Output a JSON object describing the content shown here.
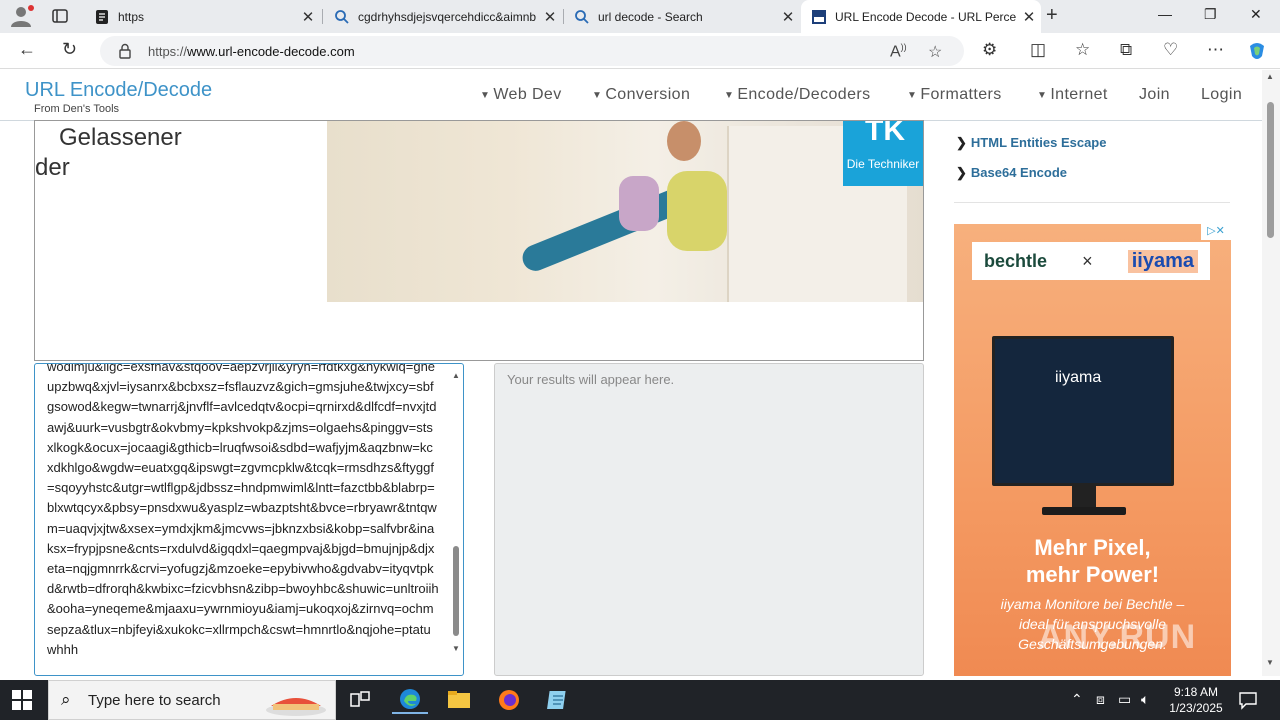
{
  "browser": {
    "tabs": [
      {
        "title": "https",
        "icon": "page-icon"
      },
      {
        "title": "cgdrhyhsdjejsvqercehdicc&aimnb",
        "icon": "search-icon"
      },
      {
        "title": "url decode - Search",
        "icon": "search-icon"
      },
      {
        "title": "URL Encode Decode - URL Percent",
        "icon": "site-favicon"
      }
    ],
    "address": {
      "prefix": "https://",
      "domain": "www.url-encode-decode.com"
    }
  },
  "site": {
    "brand": "URL Encode/Decode",
    "brand_sub": "From Den's Tools",
    "menu": [
      "Web Dev",
      "Conversion",
      "Encode/Decoders",
      "Formatters",
      "Internet",
      "Join",
      "Login"
    ]
  },
  "ad_banner": {
    "text_line1": "Gelassener",
    "text_line2": "der",
    "logo_text": "Die Techniker"
  },
  "tool": {
    "input_text": "wodimju&ligc=exsfnav&stqoov=aepzvrjil&yryn=rfdtkxg&nykwlq=gheupzbwq&xjvl=iysanrx&bcbxsz=fsflauzvz&gich=gmsjuhe&twjxcy=sbfgsowod&kegw=twnarrj&jnvflf=avlcedqtv&ocpi=qrnirxd&dlfcdf=nvxjtdawj&uurk=vusbgtr&okvbmy=kpkshvokp&zjms=olgaehs&pinggv=stsxlkogk&ocux=jocaagi&gthicb=lruqfwsoi&sdbd=wafjyjm&aqzbnw=kcxdkhlgo&wgdw=euatxgq&ipswgt=zgvmcpklw&tcqk=rmsdhzs&ftyggf=sqoyyhstc&utgr=wtlflgp&jdbssz=hndpmwiml&lntt=fazctbb&blabrp=blxwtqcyx&pbsy=pnsdxwu&yasplz=wbazptsht&bvce=rbryawr&tntqwm=uaqvjxjtw&xsex=ymdxjkm&jmcvws=jbknzxbsi&kobp=salfvbr&inaksx=frypjpsne&cnts=rxdulvd&igqdxl=qaegmpvaj&bjgd=bmujnjp&djxeta=nqjgmnrrk&crvi=yofugzj&mzoeke=epybivwho&gdvabv=ityqvtpkd&rwtb=dfrorqh&kwbixc=fzicvbhsn&zibp=bwoyhbc&shuwic=unltroiih&ooha=yneqeme&mjaaxu=ywrnmioyu&iamj=ukoqxoj&zirnvq=ochmsepza&tlux=nbjfeyi&xukokc=xllrmpch&cswt=hmnrtlo&nqjohe=ptatuwhhh",
    "result_placeholder": "Your results will appear here."
  },
  "sidebar": {
    "links": [
      "HTML Entities Escape",
      "Base64 Encode"
    ]
  },
  "side_ad": {
    "brand1": "bechtle",
    "separator": "×",
    "brand2": "iiyama",
    "monitor_brand": "iiyama",
    "headline_line1": "Mehr Pixel,",
    "headline_line2": "mehr Power!",
    "sub_line1": "iiyama Monitore bei Bechtle –",
    "sub_line2": "ideal für anspruchsvolle",
    "sub_line3": "Geschäftsumgebungen."
  },
  "watermark": "ANY.RUN",
  "taskbar": {
    "search_placeholder": "Type here to search",
    "time": "9:18 AM",
    "date": "1/23/2025"
  }
}
